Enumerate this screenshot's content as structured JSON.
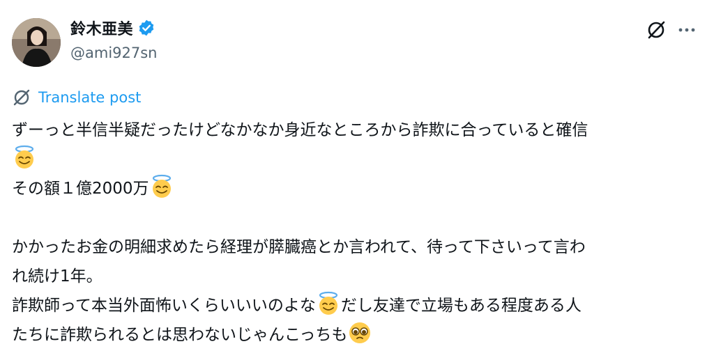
{
  "author": {
    "display_name": "鈴木亜美",
    "handle": "@ami927sn",
    "verified": true
  },
  "actions": {
    "grok_icon": "grok-icon",
    "more_icon": "more-icon"
  },
  "translate": {
    "label": "Translate post",
    "icon": "translate-icon"
  },
  "post": {
    "line1": "ずーっと半信半疑だったけどなかなか身近なところから詐欺に合っていると確信",
    "line2": "その額１億2000万",
    "line3": "かかったお金の明細求めたら経理が膵臓癌とか言われて、待って下さいって言わ",
    "line4": "れ続け1年。",
    "line5a": "詐欺師って本当外面怖いくらいいいのよな",
    "line5b": "だし友達で立場もある程度ある人",
    "line6": "たちに詐欺られるとは思わないじゃんこっちも",
    "emojis": [
      "smiling-face-with-halo",
      "smiling-face-with-halo",
      "smiling-face-with-halo",
      "pleading-face"
    ]
  },
  "colors": {
    "accent": "#1d9bf0",
    "secondary_text": "#536471",
    "primary_text": "#0f1419"
  }
}
